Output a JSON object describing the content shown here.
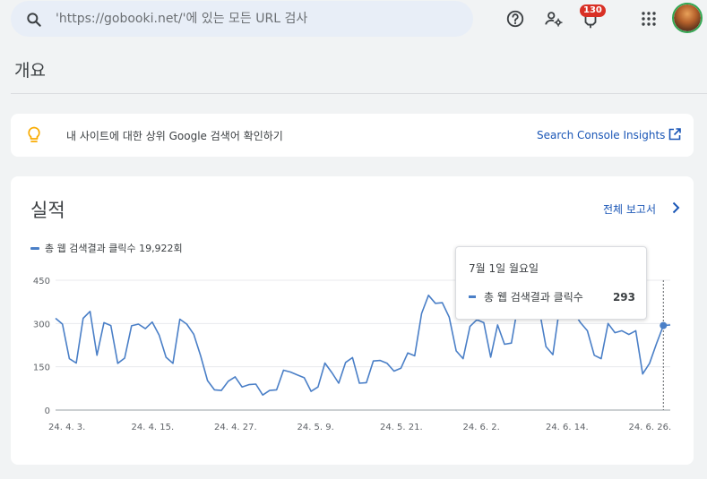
{
  "search": {
    "placeholder": "'https://gobooki.net/'에 있는 모든 URL 검사"
  },
  "header": {
    "notification_count": "130",
    "icons": [
      "help-icon",
      "manage-accounts-icon",
      "notifications-icon",
      "apps-grid-icon"
    ]
  },
  "page": {
    "title": "개요"
  },
  "banner": {
    "message": "내 사이트에 대한 상위 Google 검색어 확인하기",
    "link": "Search Console Insights"
  },
  "card": {
    "title": "실적",
    "report_link": "전체 보고서",
    "legend": "총 웹 검색결과 클릭수 19,922회"
  },
  "tooltip": {
    "date": "7월 1일 월요일",
    "label": "총 웹 검색결과 클릭수",
    "value": "293"
  },
  "colors": {
    "accent": "#1a56b6",
    "series": "#4a7fc7",
    "badge": "#d93025",
    "bulb": "#f9ab00"
  },
  "chart_data": {
    "type": "line",
    "ylim": [
      0,
      450
    ],
    "yticks": [
      "450",
      "300",
      "150",
      "0"
    ],
    "xticks": [
      "24. 4. 3.",
      "24. 4. 15.",
      "24. 4. 27.",
      "24. 5. 9.",
      "24. 5. 21.",
      "24. 6. 2.",
      "24. 6. 14.",
      "24. 6. 26."
    ],
    "series": [
      {
        "name": "총 웹 검색결과 클릭수",
        "values": [
          318,
          298,
          178,
          163,
          318,
          342,
          190,
          303,
          293,
          162,
          180,
          292,
          298,
          282,
          305,
          260,
          183,
          162,
          315,
          298,
          263,
          188,
          102,
          70,
          68,
          100,
          115,
          80,
          88,
          90,
          52,
          68,
          70,
          138,
          132,
          122,
          112,
          65,
          80,
          163,
          130,
          93,
          165,
          182,
          93,
          95,
          170,
          172,
          162,
          135,
          145,
          198,
          188,
          335,
          398,
          370,
          372,
          322,
          205,
          178,
          290,
          313,
          303,
          183,
          295,
          228,
          232,
          370,
          342,
          352,
          352,
          220,
          192,
          360,
          340,
          340,
          303,
          275,
          190,
          178,
          300,
          268,
          275,
          262,
          275,
          125,
          162,
          230,
          293,
          295
        ]
      }
    ],
    "highlight": {
      "date": "7월 1일",
      "value": 293
    }
  }
}
